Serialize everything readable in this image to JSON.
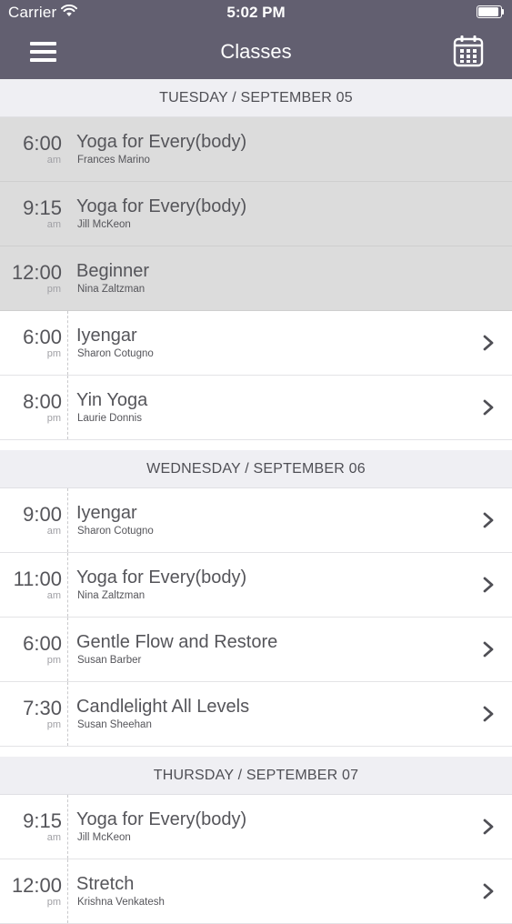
{
  "status_bar": {
    "carrier": "Carrier",
    "time": "5:02 PM",
    "battery_level": 1.0
  },
  "nav": {
    "title": "Classes",
    "menu_icon": "hamburger-menu-icon",
    "calendar_icon": "calendar-icon"
  },
  "colors": {
    "nav_bar": "#625f70",
    "section_header_bg": "#efeff3",
    "past_row_bg": "#dcdcdc",
    "text": "#55555a"
  },
  "sections": [
    {
      "header": "TUESDAY / SEPTEMBER 05",
      "classes": [
        {
          "time": "6:00",
          "ampm": "am",
          "title": "Yoga for Every(body)",
          "instructor": "Frances Marino",
          "past": true
        },
        {
          "time": "9:15",
          "ampm": "am",
          "title": "Yoga for Every(body)",
          "instructor": "Jill McKeon",
          "past": true
        },
        {
          "time": "12:00",
          "ampm": "pm",
          "title": "Beginner",
          "instructor": "Nina Zaltzman",
          "past": true
        },
        {
          "time": "6:00",
          "ampm": "pm",
          "title": "Iyengar",
          "instructor": "Sharon Cotugno",
          "past": false
        },
        {
          "time": "8:00",
          "ampm": "pm",
          "title": "Yin Yoga",
          "instructor": "Laurie Donnis",
          "past": false
        }
      ]
    },
    {
      "header": "WEDNESDAY / SEPTEMBER 06",
      "classes": [
        {
          "time": "9:00",
          "ampm": "am",
          "title": "Iyengar",
          "instructor": "Sharon Cotugno",
          "past": false
        },
        {
          "time": "11:00",
          "ampm": "am",
          "title": "Yoga for Every(body)",
          "instructor": "Nina Zaltzman",
          "past": false
        },
        {
          "time": "6:00",
          "ampm": "pm",
          "title": "Gentle Flow and Restore",
          "instructor": "Susan Barber",
          "past": false
        },
        {
          "time": "7:30",
          "ampm": "pm",
          "title": "Candlelight All Levels",
          "instructor": "Susan Sheehan",
          "past": false
        }
      ]
    },
    {
      "header": "THURSDAY / SEPTEMBER 07",
      "classes": [
        {
          "time": "9:15",
          "ampm": "am",
          "title": "Yoga for Every(body)",
          "instructor": "Jill McKeon",
          "past": false
        },
        {
          "time": "12:00",
          "ampm": "pm",
          "title": "Stretch",
          "instructor": "Krishna Venkatesh",
          "past": false
        }
      ]
    }
  ]
}
